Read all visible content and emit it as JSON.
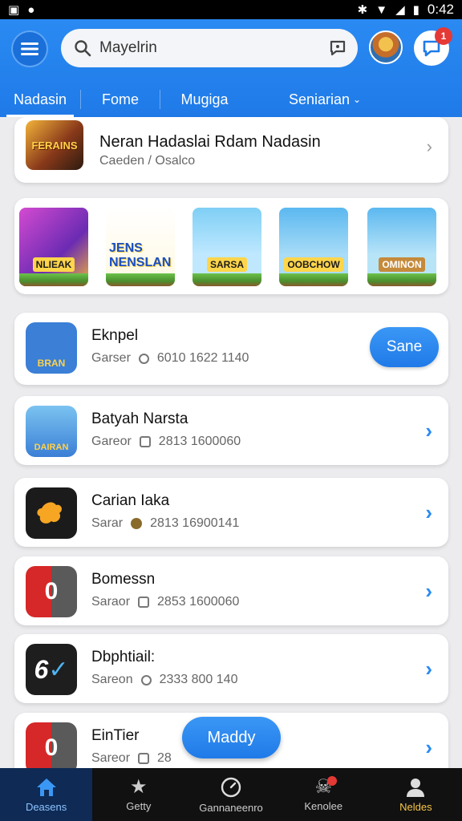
{
  "status_bar": {
    "time": "0:42"
  },
  "header": {
    "search": {
      "placeholder": "Mayelrin"
    },
    "notification_count": "1",
    "accent": "#2a8af2"
  },
  "tabs": [
    {
      "label": "Nadasin",
      "active": true
    },
    {
      "label": "Fome",
      "active": false
    },
    {
      "label": "Mugiga",
      "active": false
    },
    {
      "label": "Seniarian",
      "active": false,
      "dropdown": true
    }
  ],
  "featured": {
    "thumb_label": "FERAINS",
    "title": "Neran Hadaslai Rdam Nadasin",
    "subtitle": "Caeden / Osalco"
  },
  "carousel": [
    {
      "label": "NLIEAK"
    },
    {
      "label": "JENS NENSLAN"
    },
    {
      "label": "SARSA"
    },
    {
      "label": "OOBCHOW"
    },
    {
      "label": "OMINON"
    }
  ],
  "apps": [
    {
      "name": "Eknpel",
      "category": "Garser",
      "meta_icon": "search-icon",
      "stats": "6010   1622 1140",
      "action": "Sane",
      "icon_bg": "#3b7fd6",
      "icon_text": "BRAN"
    },
    {
      "name": "Batyah Narsta",
      "category": "Gareor",
      "meta_icon": "square-icon",
      "stats": "2813   1600060",
      "action": "chevron",
      "icon_bg": "#4a8fd0",
      "icon_text": "DAIRAN"
    },
    {
      "name": "Carian Iaka",
      "category": "Sarar",
      "meta_icon": "coin-icon",
      "stats": "2813   16900141",
      "action": "chevron",
      "icon_bg": "#1b1b1b",
      "icon_text": ""
    },
    {
      "name": "Bomessn",
      "category": "Saraor",
      "meta_icon": "square-icon",
      "stats": "2853   1600060",
      "action": "chevron",
      "icon_bg": "#2b2b2b",
      "icon_text": "0"
    },
    {
      "name": "Dbphtiail:",
      "category": "Sareon",
      "meta_icon": "search-icon",
      "stats": "2333   800 140",
      "action": "chevron",
      "icon_bg": "#1e1e1e",
      "icon_text": "6"
    },
    {
      "name": "EinTier",
      "category": "Sareor",
      "meta_icon": "square-icon",
      "stats": "28",
      "action": "chevron",
      "icon_bg": "#2b2b2b",
      "icon_text": "0"
    }
  ],
  "fab": {
    "label": "Maddy"
  },
  "bottom_nav": [
    {
      "label": "Deasens",
      "icon": "home-icon",
      "active": true
    },
    {
      "label": "Getty",
      "icon": "star-icon",
      "active": false
    },
    {
      "label": "Gannaneenro",
      "icon": "clock-icon",
      "active": false
    },
    {
      "label": "Kenolee",
      "icon": "skull-icon",
      "active": false,
      "badge": true
    },
    {
      "label": "Neldes",
      "icon": "person-icon",
      "active": false
    }
  ]
}
